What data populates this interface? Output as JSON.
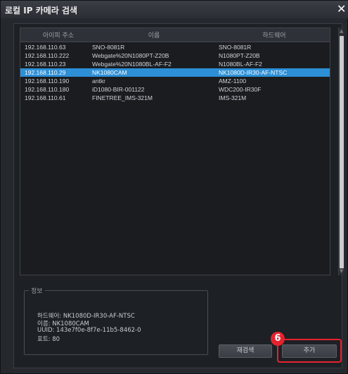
{
  "window": {
    "title": "로컬 IP 카메라 검색",
    "close_glyph": "✕"
  },
  "table": {
    "columns": [
      "아이피 주소",
      "이름",
      "하드웨어"
    ],
    "rows": [
      {
        "ip": "192.168.110.63",
        "name": "SNO-8081R",
        "hardware": "SNO-8081R",
        "selected": false
      },
      {
        "ip": "192.168.110.222",
        "name": "Webgate%20N1080PT-Z20B",
        "hardware": "N1080PT-Z20B",
        "selected": false
      },
      {
        "ip": "192.168.110.23",
        "name": "Webgate%20N1080BL-AF-F2",
        "hardware": "N1080BL-AF-F2",
        "selected": false
      },
      {
        "ip": "192.168.110.29",
        "name": "NK1080CAM",
        "hardware": "NK1080D-IR30-AF-NTSC",
        "selected": true
      },
      {
        "ip": "192.168.110.190",
        "name": "antkr",
        "hardware": "AMZ-1100",
        "selected": false
      },
      {
        "ip": "192.168.110.180",
        "name": "iD1080-BIR-001122",
        "hardware": "WDC200-IR30F",
        "selected": false
      },
      {
        "ip": "192.168.110.61",
        "name": "FINETREE_IMS-321M",
        "hardware": "IMS-321M",
        "selected": false
      }
    ]
  },
  "info": {
    "legend": "정보",
    "hardware_line": "하드웨어: NK1080D-IR30-AF-NTSC",
    "name_line": "이름: NK1080CAM",
    "uuid_line": "UUID: 143e7f0e-8f7e-11b5-8462-0",
    "port_line": "포트: 80"
  },
  "buttons": {
    "rescan_label": "재검색",
    "add_label": "추가"
  },
  "callout": {
    "number": "6",
    "color": "#e5232e"
  },
  "colors": {
    "selection": "#2d8fd6",
    "background": "#25282d"
  }
}
